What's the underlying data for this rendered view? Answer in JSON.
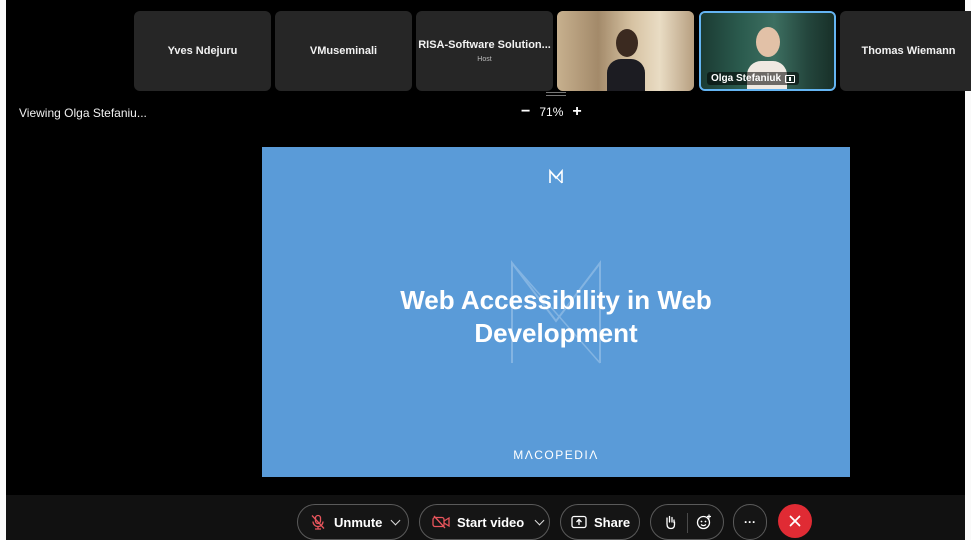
{
  "participants": [
    {
      "name": "Yves Ndejuru",
      "role": ""
    },
    {
      "name": "VMuseminali",
      "role": ""
    },
    {
      "name": "RISA-Software Solution...",
      "role": "Host"
    },
    {
      "name": "",
      "role": "",
      "video": true
    },
    {
      "name": "Olga Stefaniuk",
      "role": "",
      "video": true,
      "active": true,
      "sharing": true
    },
    {
      "name": "Thomas Wiemann",
      "role": ""
    }
  ],
  "viewing_label": "Viewing Olga Stefaniu...",
  "zoom": {
    "minus": "−",
    "level": "71%",
    "plus": "+"
  },
  "slide": {
    "title_line1": "Web Accessibility in Web",
    "title_line2": "Development",
    "brand": "MΛCOPEDIΛ",
    "background_color": "#5a9bd8"
  },
  "controls": {
    "unmute_label": "Unmute",
    "start_video_label": "Start video",
    "share_label": "Share",
    "more_label": "···",
    "end_call_color": "#e02b34"
  },
  "icons": [
    "muted-mic-icon",
    "video-off-icon",
    "share-screen-icon",
    "raise-hand-icon",
    "reactions-icon",
    "more-icon",
    "close-icon",
    "macopedia-logo-icon"
  ]
}
